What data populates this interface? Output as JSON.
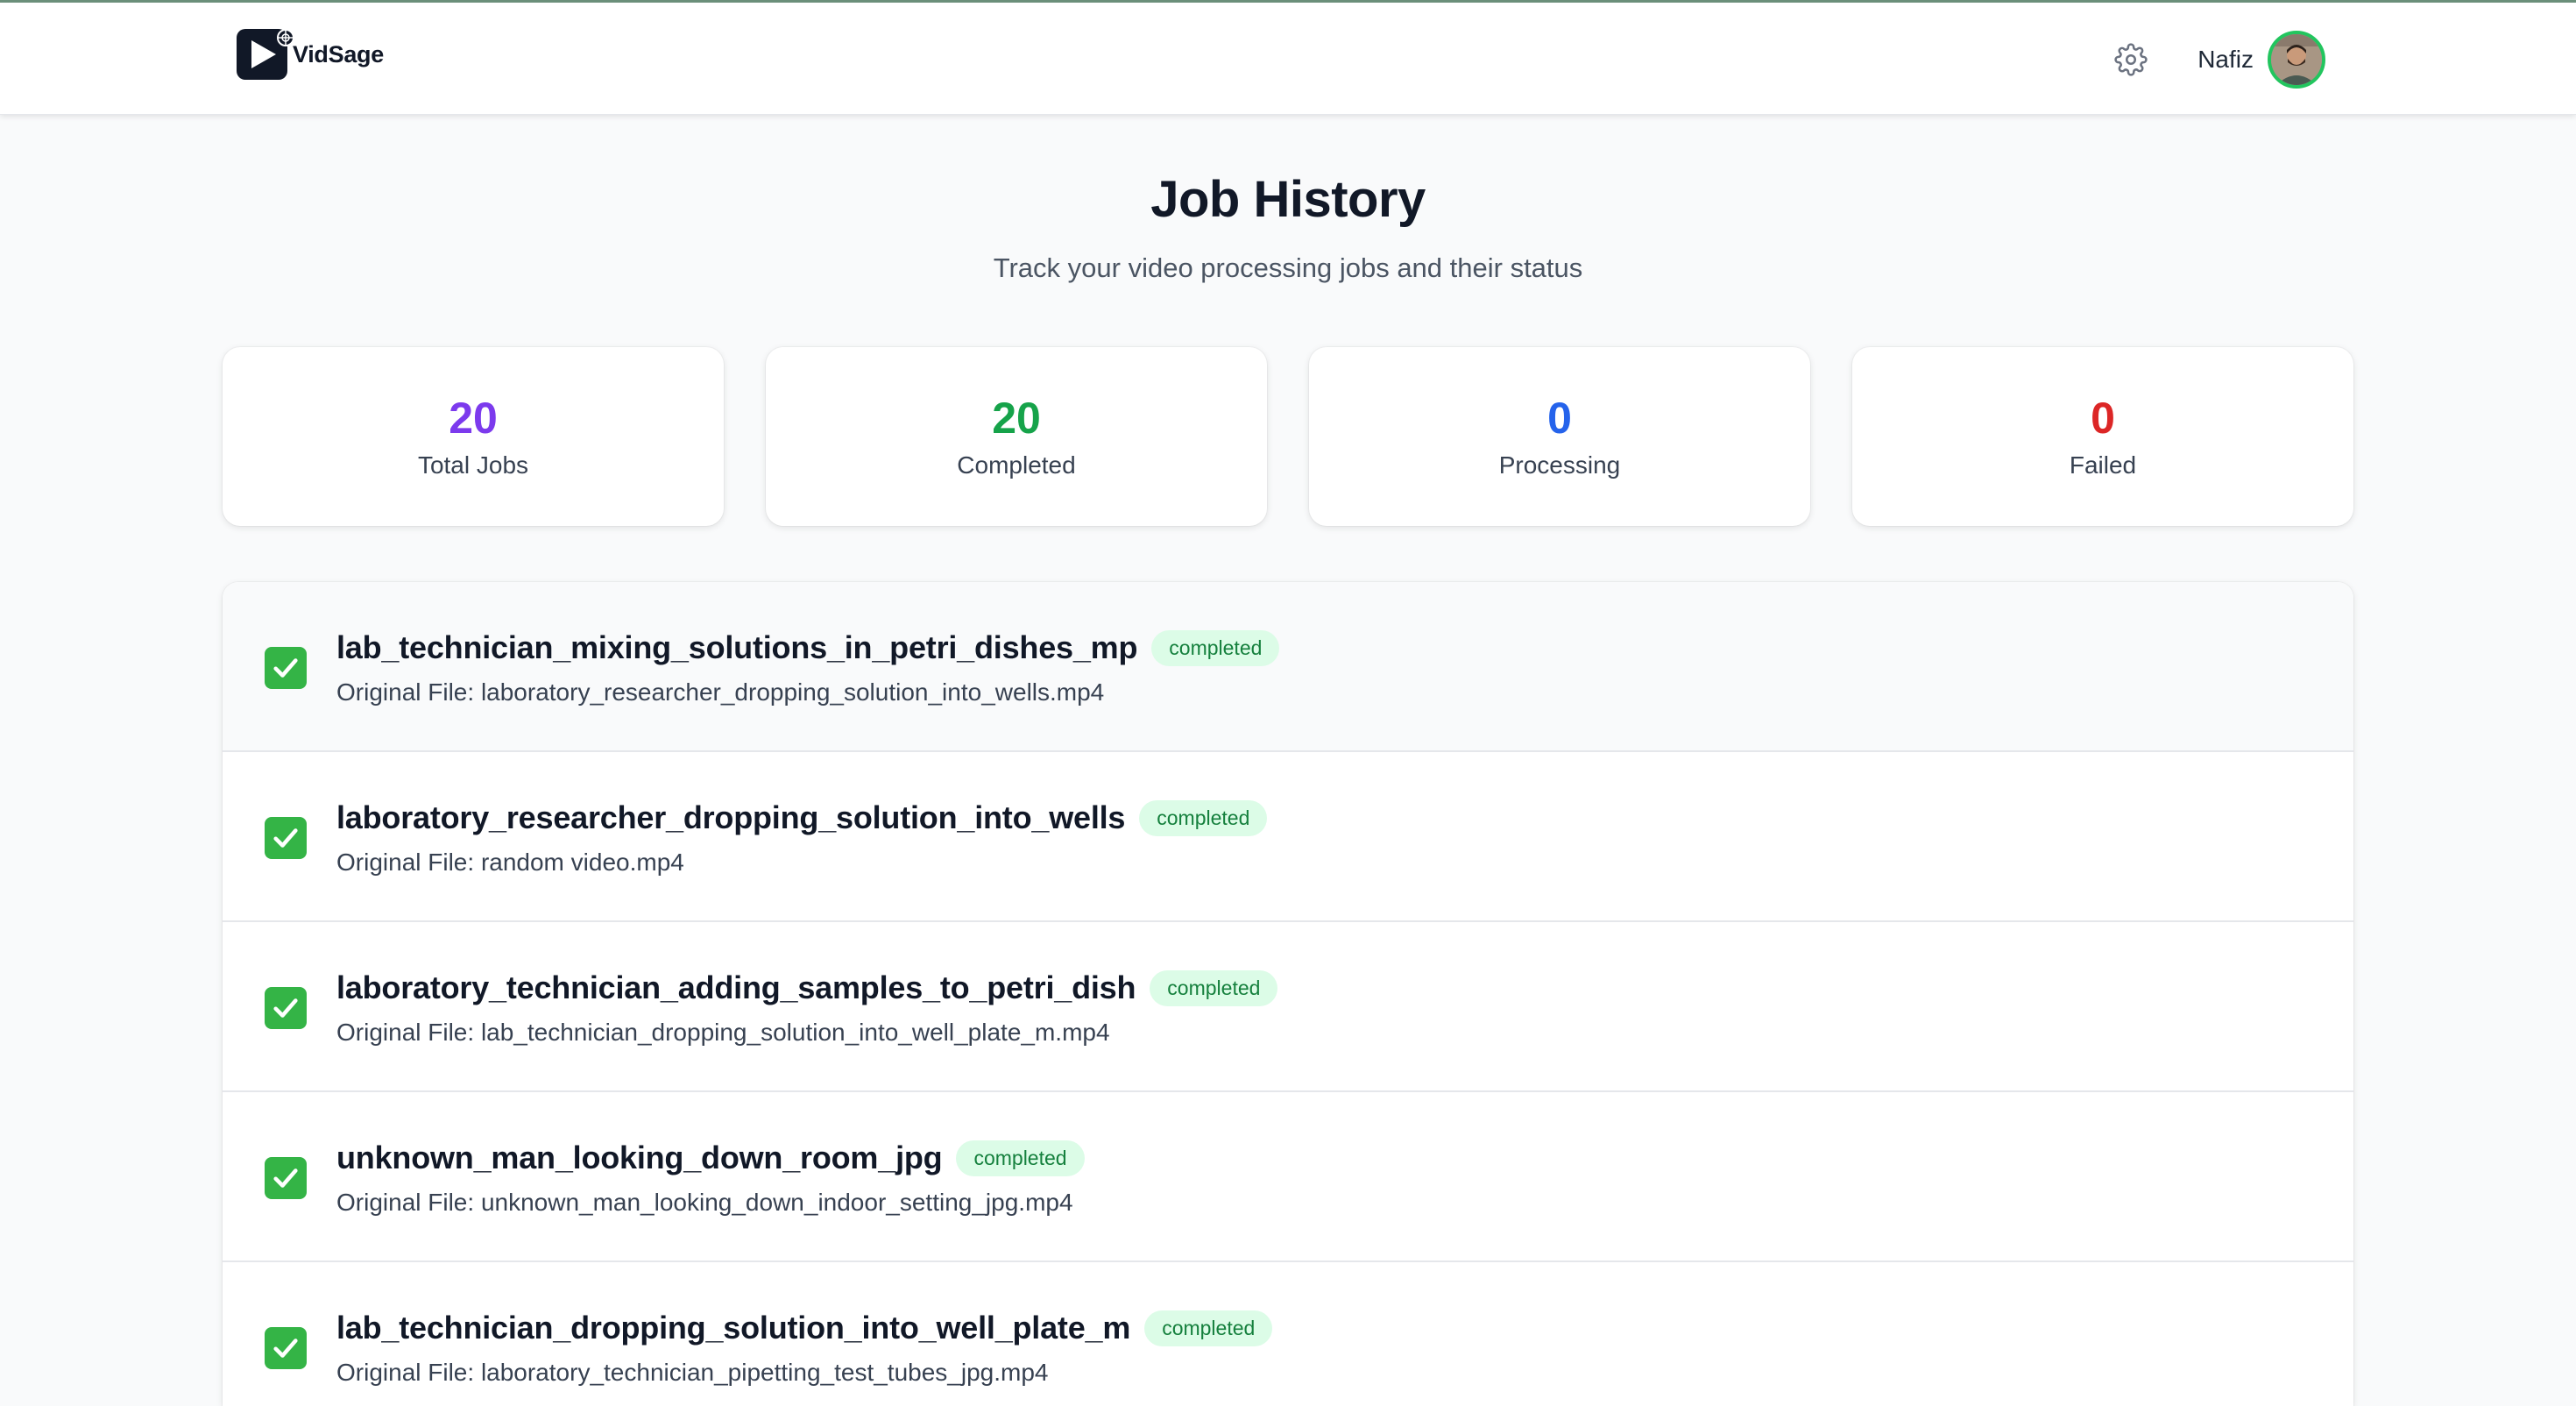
{
  "app": {
    "name": "VidSage",
    "user_name": "Nafiz"
  },
  "icons": {
    "settings": "gear-icon",
    "status": "check-icon"
  },
  "colors": {
    "total": "#7c3aed",
    "completed": "#16a34a",
    "processing": "#2563eb",
    "failed": "#dc2626",
    "badge_bg": "#dcfce7",
    "badge_text": "#15803d"
  },
  "page": {
    "title": "Job History",
    "subtitle": "Track your video processing jobs and their status"
  },
  "stats": [
    {
      "value": "20",
      "label": "Total Jobs",
      "color": "#7c3aed"
    },
    {
      "value": "20",
      "label": "Completed",
      "color": "#16a34a"
    },
    {
      "value": "0",
      "label": "Processing",
      "color": "#2563eb"
    },
    {
      "value": "0",
      "label": "Failed",
      "color": "#dc2626"
    }
  ],
  "jobs": [
    {
      "title": "lab_technician_mixing_solutions_in_petri_dishes_mp",
      "status": "completed",
      "original": "Original File: laboratory_researcher_dropping_solution_into_wells.mp4"
    },
    {
      "title": "laboratory_researcher_dropping_solution_into_wells",
      "status": "completed",
      "original": "Original File: random video.mp4"
    },
    {
      "title": "laboratory_technician_adding_samples_to_petri_dish",
      "status": "completed",
      "original": "Original File: lab_technician_dropping_solution_into_well_plate_m.mp4"
    },
    {
      "title": "unknown_man_looking_down_room_jpg",
      "status": "completed",
      "original": "Original File: unknown_man_looking_down_indoor_setting_jpg.mp4"
    },
    {
      "title": "lab_technician_dropping_solution_into_well_plate_m",
      "status": "completed",
      "original": "Original File: laboratory_technician_pipetting_test_tubes_jpg.mp4"
    }
  ]
}
